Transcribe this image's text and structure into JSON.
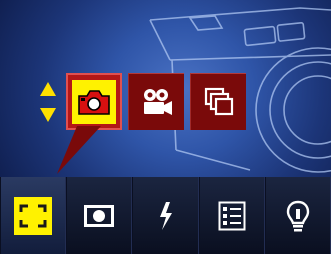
{
  "mode_menu": {
    "selected_index": 0,
    "items": [
      {
        "name": "still-photo-mode",
        "icon": "camera-icon"
      },
      {
        "name": "movie-mode",
        "icon": "video-camera-icon"
      },
      {
        "name": "multi-shot-mode",
        "icon": "stacked-frames-icon"
      }
    ],
    "colors": {
      "highlight": "#fff200",
      "tile": "#7a0a0a",
      "tile_selected": "#b31717",
      "arrows": "#ffe000"
    }
  },
  "bottom_bar": {
    "selected_index": 0,
    "items": [
      {
        "name": "focus-area",
        "icon": "focus-brackets-icon"
      },
      {
        "name": "metering",
        "icon": "metering-icon"
      },
      {
        "name": "flash",
        "icon": "lightning-icon"
      },
      {
        "name": "menu",
        "icon": "menu-list-icon"
      },
      {
        "name": "tips",
        "icon": "lightbulb-icon"
      }
    ]
  }
}
